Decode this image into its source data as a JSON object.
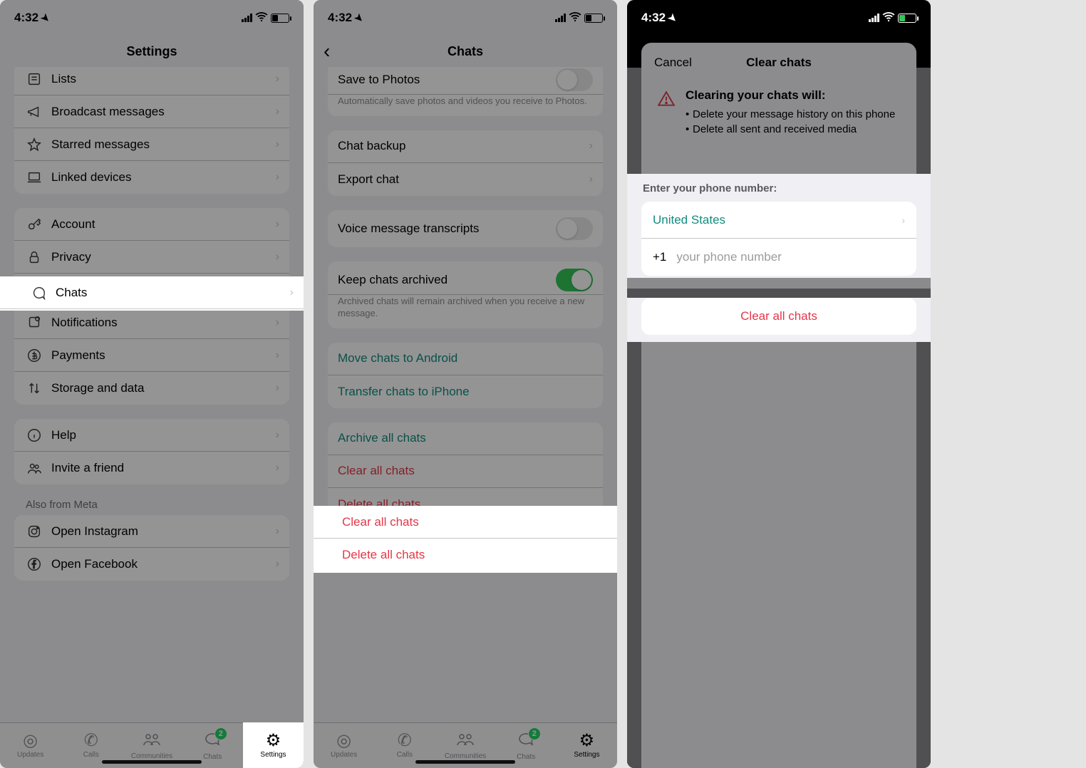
{
  "status": {
    "time": "4:32",
    "battery_pct": "31"
  },
  "phoneA": {
    "title": "Settings",
    "items_top": [
      {
        "icon": "list-icon",
        "label": "Lists"
      },
      {
        "icon": "megaphone-icon",
        "label": "Broadcast messages"
      },
      {
        "icon": "star-icon",
        "label": "Starred messages"
      },
      {
        "icon": "laptop-icon",
        "label": "Linked devices"
      }
    ],
    "items_acct": [
      {
        "icon": "key-icon",
        "label": "Account"
      },
      {
        "icon": "lock-icon",
        "label": "Privacy"
      },
      {
        "icon": "chat-icon",
        "label": "Chats"
      },
      {
        "icon": "bell-icon",
        "label": "Notifications"
      },
      {
        "icon": "currency-icon",
        "label": "Payments"
      },
      {
        "icon": "storage-icon",
        "label": "Storage and data"
      }
    ],
    "items_help": [
      {
        "icon": "info-icon",
        "label": "Help"
      },
      {
        "icon": "people-icon",
        "label": "Invite a friend"
      }
    ],
    "also_meta": "Also from Meta",
    "items_meta": [
      {
        "icon": "instagram-icon",
        "label": "Open Instagram"
      },
      {
        "icon": "facebook-icon",
        "label": "Open Facebook"
      }
    ],
    "tabs": [
      {
        "icon": "updates-icon",
        "label": "Updates"
      },
      {
        "icon": "calls-icon",
        "label": "Calls"
      },
      {
        "icon": "communities-icon",
        "label": "Communities"
      },
      {
        "icon": "chats-tab-icon",
        "label": "Chats",
        "badge": "2"
      },
      {
        "icon": "settings-tab-icon",
        "label": "Settings"
      }
    ]
  },
  "phoneB": {
    "title": "Chats",
    "save_photos": {
      "title": "Save to Photos",
      "sub": "Automatically save photos and videos you receive to Photos.",
      "on": false
    },
    "backup": [
      {
        "label": "Chat backup"
      },
      {
        "label": "Export chat"
      }
    ],
    "voice": {
      "label": "Voice message transcripts",
      "on": false
    },
    "archive": {
      "label": "Keep chats archived",
      "sub": "Archived chats will remain archived when you receive a new message.",
      "on": true
    },
    "move": [
      {
        "label": "Move chats to Android"
      },
      {
        "label": "Transfer chats to iPhone"
      }
    ],
    "danger": [
      {
        "label": "Archive all chats",
        "green": true
      },
      {
        "label": "Clear all chats",
        "green": false
      },
      {
        "label": "Delete all chats",
        "green": false
      }
    ],
    "tabs": [
      {
        "label": "Updates"
      },
      {
        "label": "Calls"
      },
      {
        "label": "Communities"
      },
      {
        "label": "Chats",
        "badge": "2"
      },
      {
        "label": "Settings"
      }
    ]
  },
  "phoneC": {
    "cancel": "Cancel",
    "title": "Clear chats",
    "warn_head": "Clearing your chats will:",
    "bullets": [
      "Delete your message history on this phone",
      "Delete all sent and received media"
    ],
    "enter_label": "Enter your phone number:",
    "country": "United States",
    "cc": "+1",
    "placeholder": "your phone number",
    "clear_btn": "Clear all chats"
  }
}
